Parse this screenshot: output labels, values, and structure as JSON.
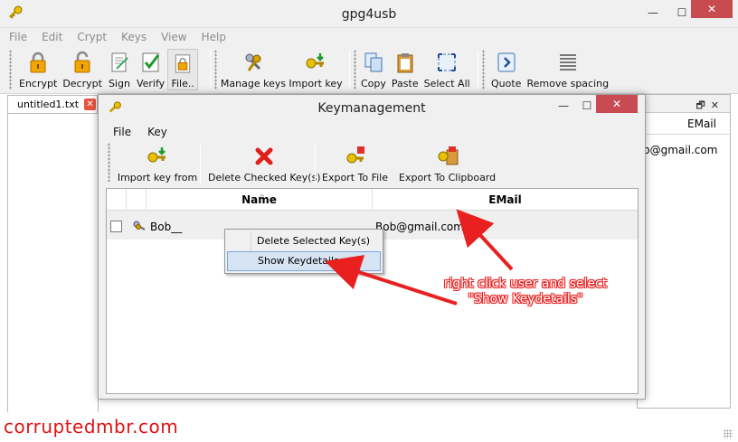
{
  "window": {
    "title": "gpg4usb",
    "close_label": "✕",
    "maximize_label": "☐",
    "minimize_label": "—"
  },
  "menu": [
    "File",
    "Edit",
    "Crypt",
    "Keys",
    "View",
    "Help"
  ],
  "toolbar": {
    "encrypt": "Encrypt",
    "decrypt": "Decrypt",
    "sign": "Sign",
    "verify": "Verify",
    "file": "File..",
    "manage_keys": "Manage keys",
    "import_key": "Import key",
    "copy": "Copy",
    "paste": "Paste",
    "select_all": "Select All",
    "quote": "Quote",
    "remove_spacing": "Remove spacing"
  },
  "tab": {
    "label": "untitled1.txt",
    "close_label": "✕"
  },
  "right_panel": {
    "column": "EMail",
    "cell": "b@gmail.com",
    "icons": "🗗✕"
  },
  "dialog": {
    "title": "Keymanagement",
    "close_label": "✕",
    "menu": [
      "File",
      "Key"
    ],
    "toolbar": {
      "import": "Import key from",
      "delete": "Delete Checked Key(s)",
      "export_file": "Export To File",
      "export_clipboard": "Export To Clipboard"
    },
    "columns": {
      "name": "Name",
      "email": "EMail"
    },
    "rows": [
      {
        "name": "Bob__",
        "email": "Bob@gmail.com"
      }
    ]
  },
  "context_menu": {
    "items": [
      "Delete Selected Key(s)",
      "Show Keydetails"
    ]
  },
  "annotation": {
    "text": "right click user and select \"Show Keydetails\"",
    "color": "#e82020"
  },
  "watermark": "corruptedmbr.com"
}
